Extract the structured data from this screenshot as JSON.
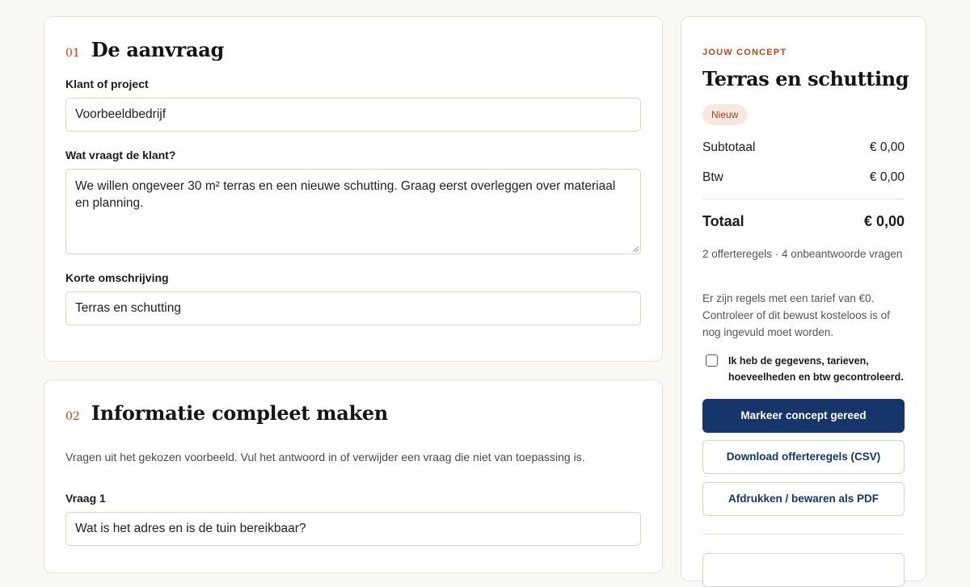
{
  "section1": {
    "number": "01",
    "title": "De aanvraag",
    "client_label": "Klant of project",
    "client_value": "Voorbeeldbedrijf",
    "request_label": "Wat vraagt de klant?",
    "request_value": "We willen ongeveer 30 m² terras en een nieuwe schutting. Graag eerst overleggen over materiaal en planning.",
    "summary_label": "Korte omschrijving",
    "summary_value": "Terras en schutting"
  },
  "section2": {
    "number": "02",
    "title": "Informatie compleet maken",
    "hint": "Vragen uit het gekozen voorbeeld. Vul het antwoord in of verwijder een vraag die niet van toepassing is.",
    "question1_label": "Vraag 1",
    "question1_value": "Wat is het adres en is de tuin bereikbaar?"
  },
  "sidebar": {
    "eyebrow": "JOUW CONCEPT",
    "title": "Terras en schutting",
    "badge": "Nieuw",
    "subtotal_label": "Subtotaal",
    "subtotal_value": "€ 0,00",
    "vat_label": "Btw",
    "vat_value": "€ 0,00",
    "total_label": "Totaal",
    "total_value": "€ 0,00",
    "stats": "2 offerteregels · 4 onbeantwoorde vragen",
    "warning": "Er zijn regels met een tarief van €0. Controleer of dit bewust kosteloos is of nog ingevuld moet worden.",
    "checkbox_label": "Ik heb de gegevens, tarieven, hoeveelheden en btw gecontroleerd.",
    "checkbox_checked": false,
    "mark_ready_button": "Markeer concept gereed",
    "download_button": "Download offerteregels (CSV)",
    "print_button": "Afdrukken / bewaren als PDF"
  },
  "colors": {
    "accent": "#b4471b",
    "primary": "#16366b",
    "badge_bg": "#f8e8df",
    "page_bg": "#f9f8f5"
  }
}
